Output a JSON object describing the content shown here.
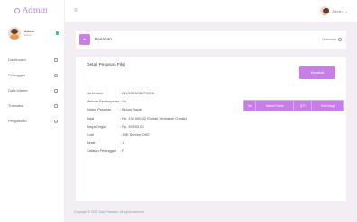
{
  "brand": {
    "title": "Admin"
  },
  "sidebar": {
    "user": {
      "name": "Admin",
      "role": "Admin"
    },
    "items": [
      {
        "label": "Dashboard",
        "icon": "dashboard-icon",
        "has_chevron": false
      },
      {
        "label": "Pelanggan",
        "icon": "people-icon",
        "has_chevron": false
      },
      {
        "label": "Data Master",
        "icon": "database-icon",
        "has_chevron": true
      },
      {
        "label": "Transaksi",
        "icon": "cart-icon",
        "has_chevron": true
      },
      {
        "label": "Pengaturan",
        "icon": "settings-icon",
        "has_chevron": true
      }
    ]
  },
  "topbar": {
    "user_label": "Admin"
  },
  "page_header": {
    "title": "Pesanan",
    "overview_label": "Overview"
  },
  "card": {
    "title": "Detail Pesanan Fikri",
    "back_label": "Kembali"
  },
  "details": [
    {
      "label": "No Invoice",
      "value": ": INV/2023/0827/9406"
    },
    {
      "label": "Metode Pembayaran",
      "value": ": VA"
    },
    {
      "label": "Status Pesanan",
      "value": ": Belum Bayar"
    },
    {
      "label": "Total",
      "value": ": Rp. 139.000,00 (Sudah Termasuk Ongkir)"
    },
    {
      "label": "Biaya Ongkir",
      "value": ": Rp. 39.000,00"
    },
    {
      "label": "Kurir",
      "value": ": JNE Service OKE"
    },
    {
      "label": "Berat",
      "value": ": 1"
    },
    {
      "label": "Catatan Pelanggan",
      "value": ": F"
    }
  ],
  "items_table": {
    "headers": [
      "No",
      "Nama Produk",
      "QTY",
      "Total Harga"
    ]
  },
  "footer": {
    "prefix": "Copyright © 2023",
    "link": "Toko Pesanan",
    "suffix": ". All rights reserved."
  },
  "colors": {
    "accent": "#c77ee6",
    "background": "#f2eef4"
  }
}
